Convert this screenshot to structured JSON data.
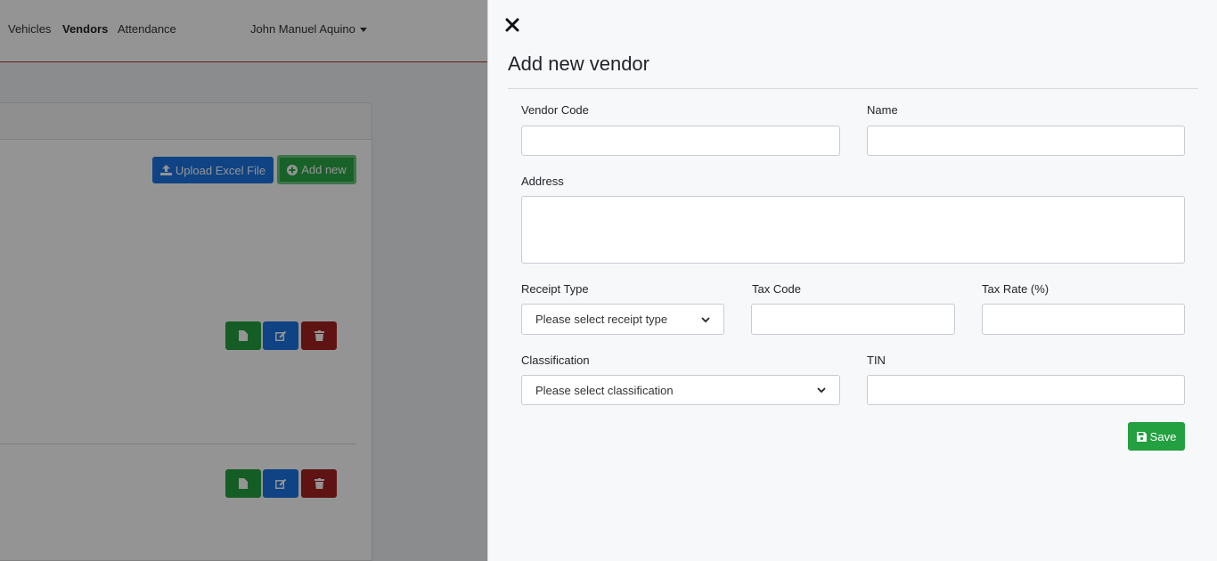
{
  "nav": {
    "items": [
      {
        "label": "Vehicles"
      },
      {
        "label": "Vendors"
      },
      {
        "label": "Attendance"
      }
    ],
    "user": "John Manuel Aquino"
  },
  "actions": {
    "upload_label": "Upload Excel File",
    "add_new_label": "Add new"
  },
  "panel": {
    "title": "Add new vendor",
    "vendor_code_label": "Vendor Code",
    "name_label": "Name",
    "address_label": "Address",
    "receipt_type_label": "Receipt Type",
    "receipt_type_value": "Please select receipt type",
    "tax_code_label": "Tax Code",
    "tax_rate_label": "Tax Rate (%)",
    "classification_label": "Classification",
    "classification_value": "Please select classification",
    "tin_label": "TIN",
    "save_label": "Save"
  },
  "colors": {
    "primary": "#1b74e4",
    "success": "#23a03f",
    "danger": "#a52222"
  }
}
